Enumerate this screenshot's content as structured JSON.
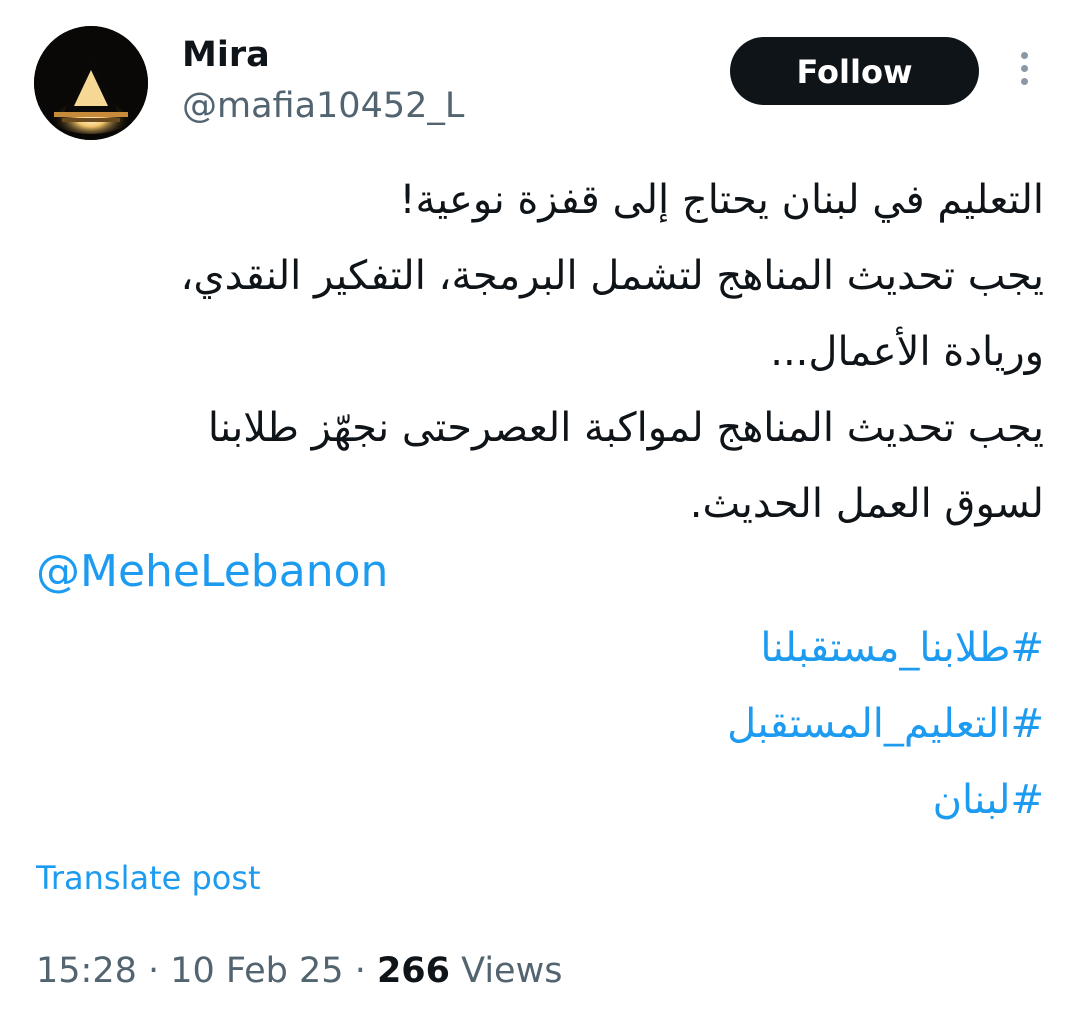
{
  "author": {
    "display_name": "Mira",
    "handle": "@mafia10452_L",
    "avatar_icon": "lamp-light-avatar"
  },
  "actions": {
    "follow_label": "Follow",
    "more_icon": "more-vertical-icon"
  },
  "post": {
    "lines": [
      "التعليم في لبنان يحتاج إلى قفزة نوعية!",
      "يجب تحديث المناهج لتشمل البرمجة، التفكير النقدي،",
      "وريادة الأعمال...",
      "يجب تحديث المناهج لمواكبة العصرحتى نجهّز طلابنا",
      "لسوق العمل الحديث."
    ],
    "mention": "@MeheLebanon",
    "hashtags": [
      "#طلابنا_مستقبلنا",
      "#التعليم_المستقبل",
      "#لبنان"
    ],
    "translate_label": "Translate post"
  },
  "meta": {
    "time": "15:28",
    "date": "10 Feb 25",
    "separator": " · ",
    "views_count": "266",
    "views_label": " Views"
  },
  "colors": {
    "link": "#1d9bf0",
    "text": "#0f1419",
    "secondary": "#536471",
    "button_bg": "#0f1419"
  }
}
